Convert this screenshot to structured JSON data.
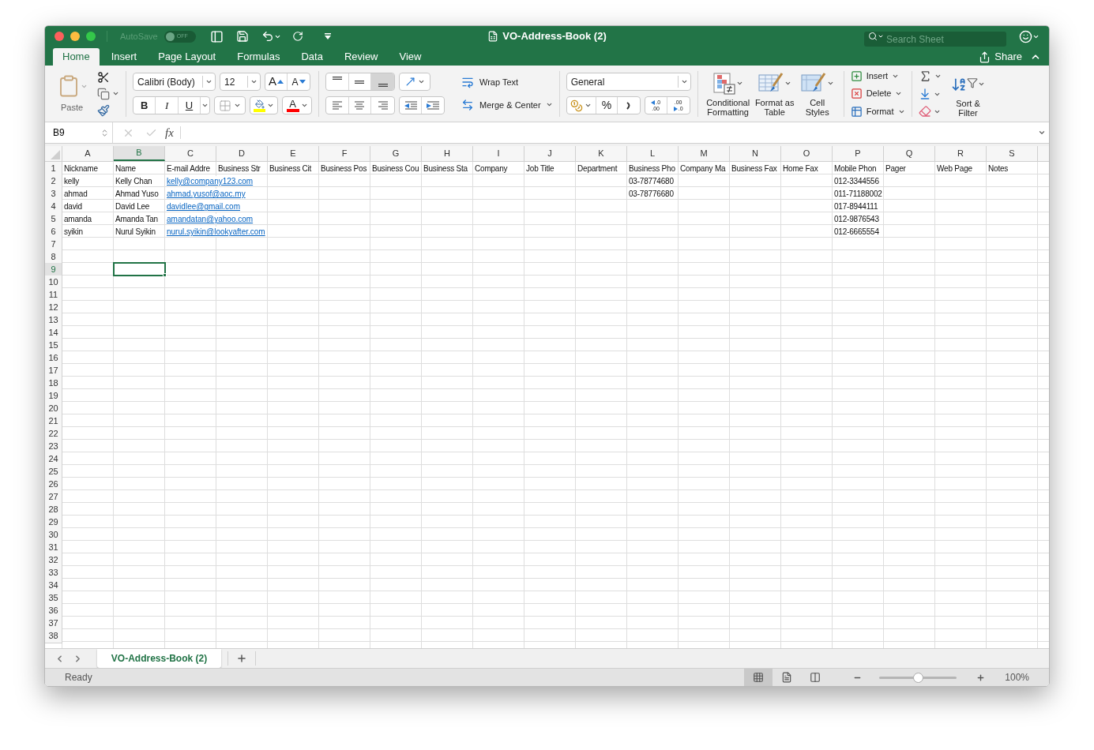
{
  "window": {
    "title": "VO-Address-Book (2)",
    "autosave": {
      "label": "AutoSave",
      "on": false,
      "state_label": "OFF"
    }
  },
  "search": {
    "placeholder": "Search Sheet"
  },
  "tabs": [
    {
      "label": "Home",
      "selected": true
    },
    {
      "label": "Insert",
      "selected": false
    },
    {
      "label": "Page Layout",
      "selected": false
    },
    {
      "label": "Formulas",
      "selected": false
    },
    {
      "label": "Data",
      "selected": false
    },
    {
      "label": "Review",
      "selected": false
    },
    {
      "label": "View",
      "selected": false
    }
  ],
  "share": {
    "label": "Share"
  },
  "ribbon": {
    "paste": "Paste",
    "font_name": "Calibri (Body)",
    "font_size": "12",
    "grow_label": "A",
    "shrink_label": "A",
    "style_buttons": [
      {
        "label": "B",
        "kind": "bold"
      },
      {
        "label": "I",
        "kind": "italic"
      },
      {
        "label": "U",
        "kind": "underline"
      }
    ],
    "font_color_label": "A",
    "vertical_align": [
      {
        "kind": "top",
        "selected": false
      },
      {
        "kind": "middle",
        "selected": false
      },
      {
        "kind": "bottom",
        "selected": true
      }
    ],
    "horizontal_align": [
      {
        "kind": "left",
        "selected": false
      },
      {
        "kind": "center",
        "selected": false
      },
      {
        "kind": "right",
        "selected": false
      }
    ],
    "wrap_text": "Wrap Text",
    "merge_center": "Merge & Center",
    "number_format": "General",
    "percent": "%",
    "increase_decimal": [
      ".0",
      ".00"
    ],
    "decrease_decimal": [
      ".00",
      ".0"
    ],
    "styles": [
      {
        "label": "Conditional Formatting",
        "kind": "conditional"
      },
      {
        "label": "Format as Table",
        "kind": "table"
      },
      {
        "label": "Cell Styles",
        "kind": "cell"
      }
    ],
    "cells": [
      {
        "label": "Insert",
        "kind": "insert"
      },
      {
        "label": "Delete",
        "kind": "delete"
      },
      {
        "label": "Format",
        "kind": "format"
      }
    ],
    "sort_filter": "Sort & Filter"
  },
  "formula_bar": {
    "name_box": "B9",
    "function_label": "fx"
  },
  "sheet": {
    "columns": [
      {
        "label": "A",
        "selected": false
      },
      {
        "label": "B",
        "selected": true
      },
      {
        "label": "C",
        "selected": false
      },
      {
        "label": "D",
        "selected": false
      },
      {
        "label": "E",
        "selected": false
      },
      {
        "label": "F",
        "selected": false
      },
      {
        "label": "G",
        "selected": false
      },
      {
        "label": "H",
        "selected": false
      },
      {
        "label": "I",
        "selected": false
      },
      {
        "label": "J",
        "selected": false
      },
      {
        "label": "K",
        "selected": false
      },
      {
        "label": "L",
        "selected": false
      },
      {
        "label": "M",
        "selected": false
      },
      {
        "label": "N",
        "selected": false
      },
      {
        "label": "O",
        "selected": false
      },
      {
        "label": "P",
        "selected": false
      },
      {
        "label": "Q",
        "selected": false
      },
      {
        "label": "R",
        "selected": false
      },
      {
        "label": "S",
        "selected": false
      }
    ],
    "rows": [
      {
        "label": "1",
        "selected": false,
        "cells": [
          {
            "text": "Nickname",
            "kind": "text"
          },
          {
            "text": "Name",
            "kind": "text"
          },
          {
            "text": "E-mail Addre",
            "kind": "text"
          },
          {
            "text": "Business Str",
            "kind": "text"
          },
          {
            "text": "Business Cit",
            "kind": "text"
          },
          {
            "text": "Business Pos",
            "kind": "text"
          },
          {
            "text": "Business Cou",
            "kind": "text"
          },
          {
            "text": "Business Sta",
            "kind": "text"
          },
          {
            "text": "Company",
            "kind": "text"
          },
          {
            "text": "Job Title",
            "kind": "text"
          },
          {
            "text": "Department",
            "kind": "text"
          },
          {
            "text": "Business Pho",
            "kind": "text"
          },
          {
            "text": "Company Ma",
            "kind": "text"
          },
          {
            "text": "Business Fax",
            "kind": "text"
          },
          {
            "text": "Home Fax",
            "kind": "text"
          },
          {
            "text": "Mobile Phon",
            "kind": "text"
          },
          {
            "text": "Pager",
            "kind": "text"
          },
          {
            "text": "Web Page",
            "kind": "text"
          },
          {
            "text": "Notes",
            "kind": "text"
          }
        ]
      },
      {
        "label": "2",
        "selected": false,
        "cells": [
          {
            "text": "kelly",
            "kind": "text"
          },
          {
            "text": "Kelly Chan",
            "kind": "text"
          },
          {
            "text": "kelly@company123.com",
            "kind": "link"
          },
          null,
          null,
          null,
          null,
          null,
          null,
          null,
          null,
          {
            "text": "03-78774680",
            "kind": "text"
          },
          null,
          null,
          null,
          {
            "text": "012-3344556",
            "kind": "text"
          },
          null,
          null,
          null
        ]
      },
      {
        "label": "3",
        "selected": false,
        "cells": [
          {
            "text": "ahmad",
            "kind": "text"
          },
          {
            "text": "Ahmad Yuso",
            "kind": "text"
          },
          {
            "text": "ahmad.yusof@aoc.my",
            "kind": "link"
          },
          null,
          null,
          null,
          null,
          null,
          null,
          null,
          null,
          {
            "text": "03-78776680",
            "kind": "text"
          },
          null,
          null,
          null,
          {
            "text": "011-71188002",
            "kind": "text"
          },
          null,
          null,
          null
        ]
      },
      {
        "label": "4",
        "selected": false,
        "cells": [
          {
            "text": "david",
            "kind": "text"
          },
          {
            "text": "David Lee",
            "kind": "text"
          },
          {
            "text": "davidlee@gmail.com",
            "kind": "link"
          },
          null,
          null,
          null,
          null,
          null,
          null,
          null,
          null,
          null,
          null,
          null,
          null,
          {
            "text": "017-8944111",
            "kind": "text"
          },
          null,
          null,
          null
        ]
      },
      {
        "label": "5",
        "selected": false,
        "cells": [
          {
            "text": "amanda",
            "kind": "text"
          },
          {
            "text": "Amanda Tan",
            "kind": "text"
          },
          {
            "text": "amandatan@yahoo.com",
            "kind": "link"
          },
          null,
          null,
          null,
          null,
          null,
          null,
          null,
          null,
          null,
          null,
          null,
          null,
          {
            "text": "012-9876543",
            "kind": "text"
          },
          null,
          null,
          null
        ]
      },
      {
        "label": "6",
        "selected": false,
        "cells": [
          {
            "text": "syikin",
            "kind": "text"
          },
          {
            "text": "Nurul Syikin",
            "kind": "text"
          },
          {
            "text": "nurul.syikin@lookyafter.com",
            "kind": "link"
          },
          null,
          null,
          null,
          null,
          null,
          null,
          null,
          null,
          null,
          null,
          null,
          null,
          {
            "text": "012-6665554",
            "kind": "text"
          },
          null,
          null,
          null
        ]
      },
      {
        "label": "7",
        "selected": false
      },
      {
        "label": "8",
        "selected": false
      },
      {
        "label": "9",
        "selected": true
      },
      {
        "label": "10",
        "selected": false
      },
      {
        "label": "11",
        "selected": false
      },
      {
        "label": "12",
        "selected": false
      },
      {
        "label": "13",
        "selected": false
      },
      {
        "label": "14",
        "selected": false
      },
      {
        "label": "15",
        "selected": false
      },
      {
        "label": "16",
        "selected": false
      },
      {
        "label": "17",
        "selected": false
      },
      {
        "label": "18",
        "selected": false
      },
      {
        "label": "19",
        "selected": false
      },
      {
        "label": "20",
        "selected": false
      },
      {
        "label": "21",
        "selected": false
      },
      {
        "label": "22",
        "selected": false
      },
      {
        "label": "23",
        "selected": false
      },
      {
        "label": "24",
        "selected": false
      },
      {
        "label": "25",
        "selected": false
      },
      {
        "label": "26",
        "selected": false
      },
      {
        "label": "27",
        "selected": false
      },
      {
        "label": "28",
        "selected": false
      },
      {
        "label": "29",
        "selected": false
      },
      {
        "label": "30",
        "selected": false
      },
      {
        "label": "31",
        "selected": false
      },
      {
        "label": "32",
        "selected": false
      },
      {
        "label": "33",
        "selected": false
      },
      {
        "label": "34",
        "selected": false
      },
      {
        "label": "35",
        "selected": false
      },
      {
        "label": "36",
        "selected": false
      },
      {
        "label": "37",
        "selected": false
      },
      {
        "label": "38",
        "selected": false
      }
    ]
  },
  "sheet_tabs": [
    {
      "label": "VO-Address-Book (2)",
      "selected": true
    }
  ],
  "status_bar": {
    "status": "Ready",
    "views": [
      {
        "kind": "normal",
        "selected": true
      },
      {
        "kind": "page_layout",
        "selected": false
      },
      {
        "kind": "page_break",
        "selected": false
      }
    ],
    "zoom": {
      "level": 0.5,
      "reading": "100%"
    }
  }
}
